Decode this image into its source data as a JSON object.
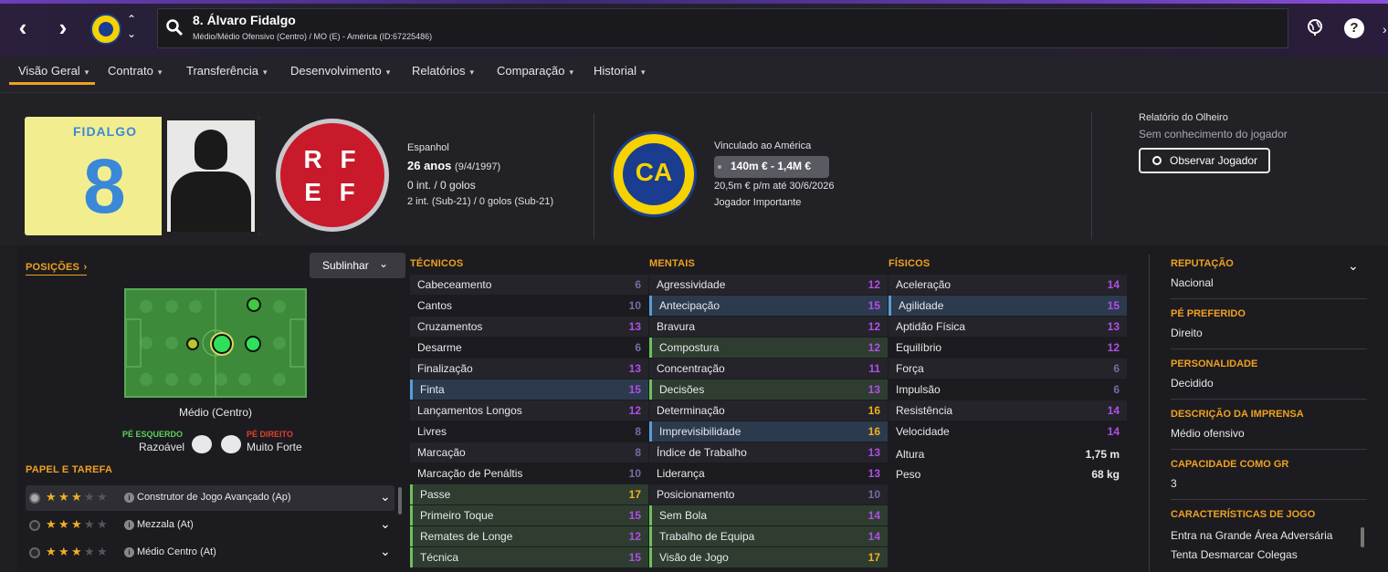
{
  "header_bar": {
    "player_title": "8. Álvaro Fidalgo",
    "player_subtitle": "Médio/Médio Ofensivo (Centro) / MO (E) - América (ID:67225486)"
  },
  "tabs": [
    {
      "label": "Visão Geral"
    },
    {
      "label": "Contrato"
    },
    {
      "label": "Transferência"
    },
    {
      "label": "Desenvolvimento"
    },
    {
      "label": "Relatórios"
    },
    {
      "label": "Comparação"
    },
    {
      "label": "Historial"
    }
  ],
  "kit": {
    "name": "FIDALGO",
    "number": "8"
  },
  "fed_badge": {
    "line1": "R F",
    "line2": "E F"
  },
  "club_badge": {
    "text": "CA"
  },
  "bio": {
    "nationality": "Espanhol",
    "age": "26 anos",
    "dob": "(9/4/1997)",
    "caps": "0 int. / 0 golos",
    "u21_caps": "2 int. (Sub-21) / 0 golos (Sub-21)"
  },
  "contract": {
    "club_line": "Vinculado ao América",
    "value": "140m € - 1,4M €",
    "wage": "20,5m € p/m até 30/6/2026",
    "status": "Jogador Importante"
  },
  "scout": {
    "title": "Relatório do Olheiro",
    "note": "Sem conhecimento do jogador",
    "button": "Observar Jogador"
  },
  "positions": {
    "heading": "POSIÇÕES",
    "highlight_button": "Sublinhar",
    "role_label": "Médio (Centro)",
    "left_foot_label": "PÉ ESQUERDO",
    "left_foot_value": "Razoável",
    "right_foot_label": "PÉ DIREITO",
    "right_foot_value": "Muito Forte"
  },
  "roles": {
    "heading": "PAPEL E TAREFA",
    "items": [
      {
        "label": "Construtor de Jogo Avançado (Ap)",
        "stars": 3
      },
      {
        "label": "Mezzala (At)",
        "stars": 3
      },
      {
        "label": "Médio Centro (At)",
        "stars": 3
      }
    ]
  },
  "technical": {
    "heading": "TÉCNICOS",
    "rows": [
      {
        "name": "Cabeceamento",
        "value": "6"
      },
      {
        "name": "Cantos",
        "value": "10"
      },
      {
        "name": "Cruzamentos",
        "value": "13"
      },
      {
        "name": "Desarme",
        "value": "6"
      },
      {
        "name": "Finalização",
        "value": "13"
      },
      {
        "name": "Finta",
        "value": "15"
      },
      {
        "name": "Lançamentos Longos",
        "value": "12"
      },
      {
        "name": "Livres",
        "value": "8"
      },
      {
        "name": "Marcação",
        "value": "8"
      },
      {
        "name": "Marcação de Penáltis",
        "value": "10"
      },
      {
        "name": "Passe",
        "value": "17"
      },
      {
        "name": "Primeiro Toque",
        "value": "15"
      },
      {
        "name": "Remates de Longe",
        "value": "12"
      },
      {
        "name": "Técnica",
        "value": "15"
      }
    ]
  },
  "mental": {
    "heading": "MENTAIS",
    "rows": [
      {
        "name": "Agressividade",
        "value": "12"
      },
      {
        "name": "Antecipação",
        "value": "15"
      },
      {
        "name": "Bravura",
        "value": "12"
      },
      {
        "name": "Compostura",
        "value": "12"
      },
      {
        "name": "Concentração",
        "value": "11"
      },
      {
        "name": "Decisões",
        "value": "13"
      },
      {
        "name": "Determinação",
        "value": "16"
      },
      {
        "name": "Imprevisibilidade",
        "value": "16"
      },
      {
        "name": "Índice de Trabalho",
        "value": "13"
      },
      {
        "name": "Liderança",
        "value": "13"
      },
      {
        "name": "Posicionamento",
        "value": "10"
      },
      {
        "name": "Sem Bola",
        "value": "14"
      },
      {
        "name": "Trabalho de Equipa",
        "value": "14"
      },
      {
        "name": "Visão de Jogo",
        "value": "17"
      }
    ]
  },
  "physical": {
    "heading": "FÍSICOS",
    "rows": [
      {
        "name": "Aceleração",
        "value": "14"
      },
      {
        "name": "Agilidade",
        "value": "15"
      },
      {
        "name": "Aptidão Física",
        "value": "13"
      },
      {
        "name": "Equilíbrio",
        "value": "12"
      },
      {
        "name": "Força",
        "value": "6"
      },
      {
        "name": "Impulsão",
        "value": "6"
      },
      {
        "name": "Resistência",
        "value": "14"
      },
      {
        "name": "Velocidade",
        "value": "14"
      }
    ],
    "height_label": "Altura",
    "height_value": "1,75 m",
    "weight_label": "Peso",
    "weight_value": "68 kg"
  },
  "info": {
    "reputation_label": "REPUTAÇÃO",
    "reputation_value": "Nacional",
    "foot_label": "PÉ PREFERIDO",
    "foot_value": "Direito",
    "personality_label": "PERSONALIDADE",
    "personality_value": "Decidido",
    "press_label": "DESCRIÇÃO DA IMPRENSA",
    "press_value": "Médio ofensivo",
    "gk_label": "CAPACIDADE COMO GR",
    "gk_value": "3",
    "traits_label": "CARACTERÍSTICAS DE JOGO",
    "traits": [
      "Entra na Grande Área Adversária",
      "Tenta Desmarcar Colegas"
    ]
  },
  "colors": {
    "accent": "#f0a020",
    "purple": "#b04fe8",
    "highlight_blue": "#5b9bd5",
    "highlight_green": "#6fbf5f"
  }
}
